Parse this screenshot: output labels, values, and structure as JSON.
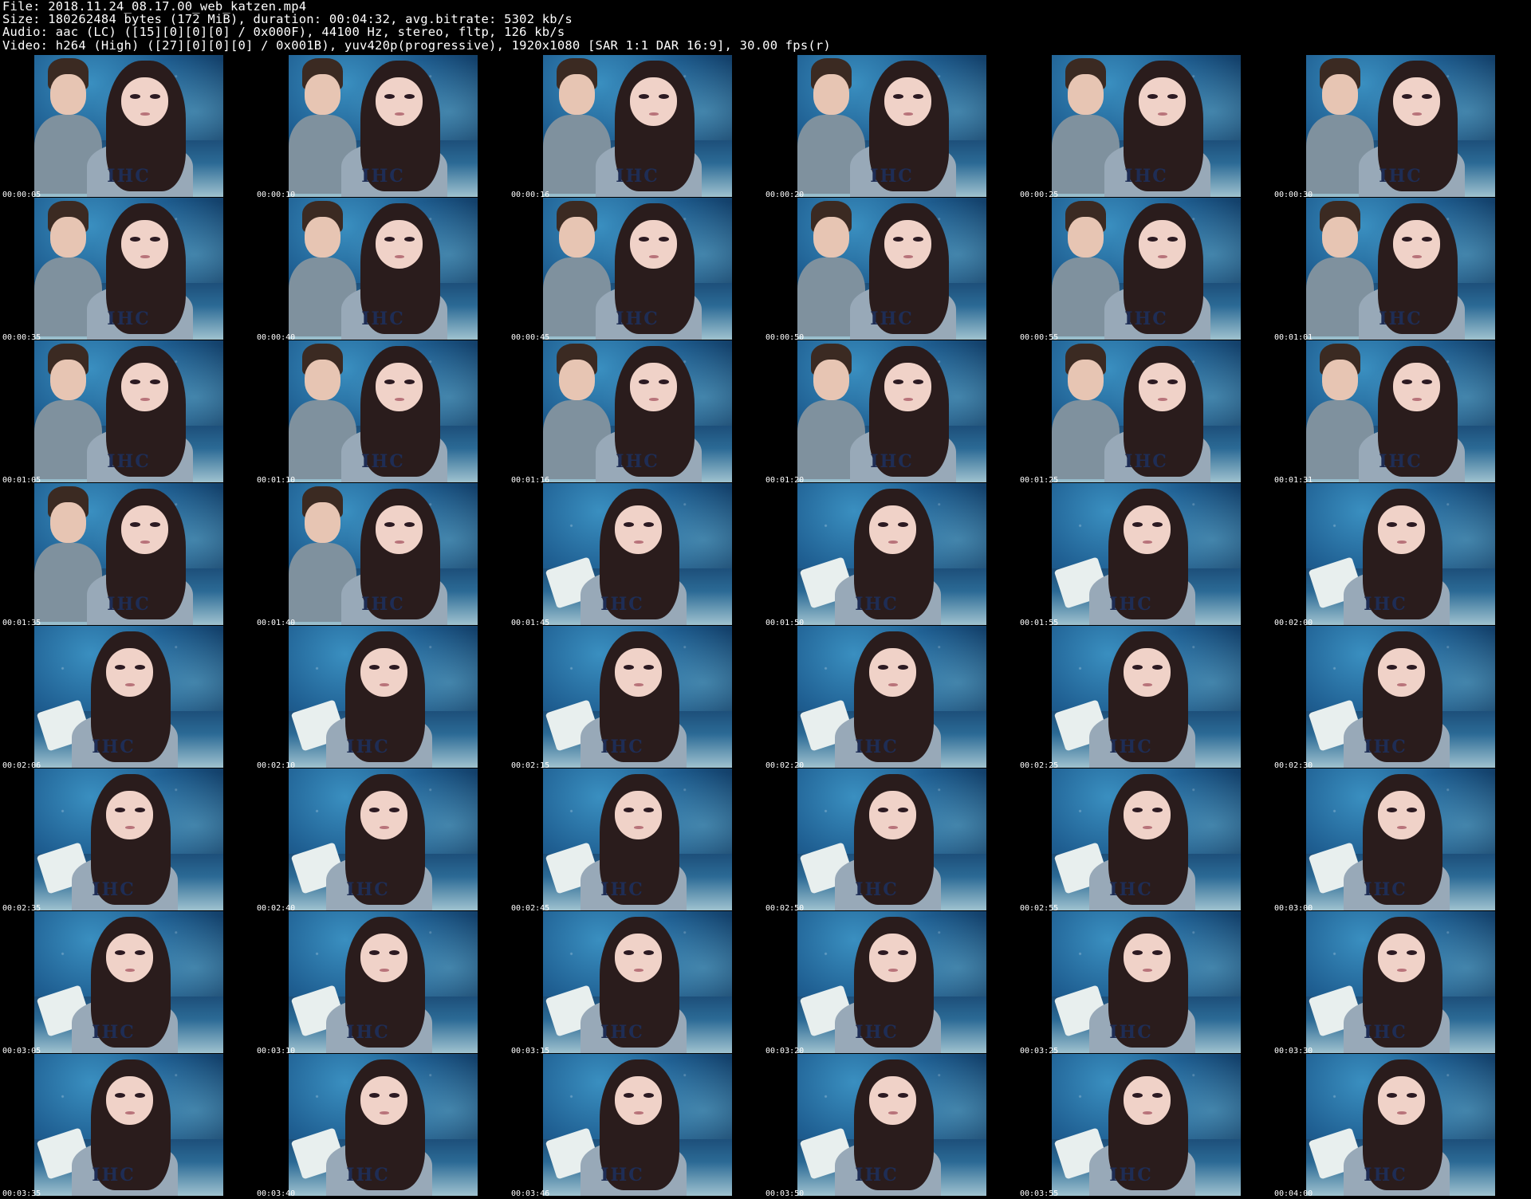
{
  "header": {
    "file_line": "File: 2018.11.24_08.17.00_web_katzen.mp4",
    "size_line": "Size: 180262484 bytes (172 MiB), duration: 00:04:32, avg.bitrate: 5302 kb/s",
    "audio_line": "Audio: aac (LC) ([15][0][0][0] / 0x000F), 44100 Hz, stereo, fltp, 126 kb/s",
    "video_line": "Video: h264 (High) ([27][0][0][0] / 0x001B), yuv420p(progressive), 1920x1080 [SAR 1:1 DAR 16:9], 30.00 fps(r)"
  },
  "thumbnails": [
    {
      "time": "00:00:05",
      "variant": "pair"
    },
    {
      "time": "00:00:10",
      "variant": "pair"
    },
    {
      "time": "00:00:16",
      "variant": "pair"
    },
    {
      "time": "00:00:20",
      "variant": "pair"
    },
    {
      "time": "00:00:25",
      "variant": "pair"
    },
    {
      "time": "00:00:30",
      "variant": "pair"
    },
    {
      "time": "00:00:35",
      "variant": "pair"
    },
    {
      "time": "00:00:40",
      "variant": "pair"
    },
    {
      "time": "00:00:45",
      "variant": "pair"
    },
    {
      "time": "00:00:50",
      "variant": "pair"
    },
    {
      "time": "00:00:55",
      "variant": "pair"
    },
    {
      "time": "00:01:01",
      "variant": "pair"
    },
    {
      "time": "00:01:05",
      "variant": "pair"
    },
    {
      "time": "00:01:10",
      "variant": "pair"
    },
    {
      "time": "00:01:16",
      "variant": "pair"
    },
    {
      "time": "00:01:20",
      "variant": "pair"
    },
    {
      "time": "00:01:25",
      "variant": "pair"
    },
    {
      "time": "00:01:31",
      "variant": "pair"
    },
    {
      "time": "00:01:35",
      "variant": "pair"
    },
    {
      "time": "00:01:40",
      "variant": "pair"
    },
    {
      "time": "00:01:45",
      "variant": "solo"
    },
    {
      "time": "00:01:50",
      "variant": "solo"
    },
    {
      "time": "00:01:55",
      "variant": "solo"
    },
    {
      "time": "00:02:00",
      "variant": "solo"
    },
    {
      "time": "00:02:06",
      "variant": "solo"
    },
    {
      "time": "00:02:10",
      "variant": "solo"
    },
    {
      "time": "00:02:15",
      "variant": "solo"
    },
    {
      "time": "00:02:20",
      "variant": "solo"
    },
    {
      "time": "00:02:25",
      "variant": "solo"
    },
    {
      "time": "00:02:30",
      "variant": "solo"
    },
    {
      "time": "00:02:35",
      "variant": "solo"
    },
    {
      "time": "00:02:40",
      "variant": "solo"
    },
    {
      "time": "00:02:45",
      "variant": "solo"
    },
    {
      "time": "00:02:50",
      "variant": "solo"
    },
    {
      "time": "00:02:55",
      "variant": "solo"
    },
    {
      "time": "00:03:00",
      "variant": "solo"
    },
    {
      "time": "00:03:05",
      "variant": "solo"
    },
    {
      "time": "00:03:10",
      "variant": "solo"
    },
    {
      "time": "00:03:15",
      "variant": "solo"
    },
    {
      "time": "00:03:20",
      "variant": "solo"
    },
    {
      "time": "00:03:25",
      "variant": "solo"
    },
    {
      "time": "00:03:30",
      "variant": "solo"
    },
    {
      "time": "00:03:35",
      "variant": "solo"
    },
    {
      "time": "00:03:40",
      "variant": "solo"
    },
    {
      "time": "00:03:46",
      "variant": "solo"
    },
    {
      "time": "00:03:50",
      "variant": "solo"
    },
    {
      "time": "00:03:55",
      "variant": "solo"
    },
    {
      "time": "00:04:00",
      "variant": "solo"
    }
  ],
  "shirt_text": "IHC"
}
